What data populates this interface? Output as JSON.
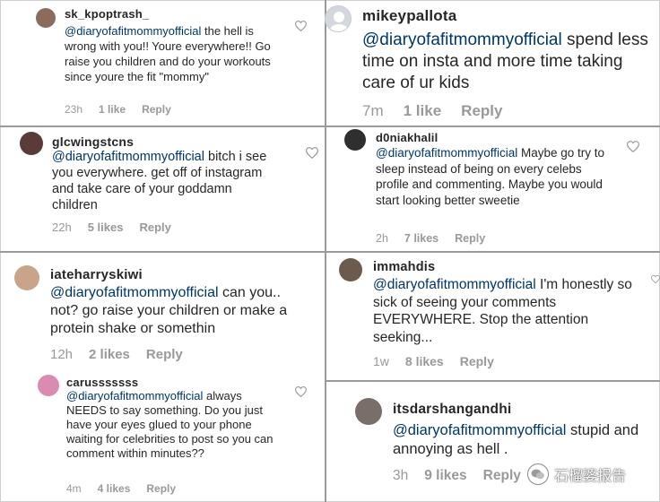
{
  "comments": [
    {
      "username": "sk_kpoptrash_",
      "mention": "@diaryofafitmommyofficial",
      "body": " the hell is wrong with you!! Youre everywhere!! Go raise you children and do your workouts since youre the fit \"mommy\"",
      "time": "23h",
      "likes": "1 like",
      "reply": "Reply",
      "avatar_color": "#8a6b5c"
    },
    {
      "username": "glcwingstcns",
      "mention": "@diaryofafitmommyofficial",
      "body": " bitch i see you everywhere. get off of instagram and take care of your goddamn children",
      "time": "22h",
      "likes": "5 likes",
      "reply": "Reply",
      "avatar_color": "#5b3a3a"
    },
    {
      "username": "iateharryskiwi",
      "mention": "@diaryofafitmommyofficial",
      "body": " can you.. not? go raise your children or make a protein shake or somethin",
      "time": "12h",
      "likes": "2 likes",
      "reply": "Reply",
      "avatar_color": "#c9a48a"
    },
    {
      "username": "carusssssss",
      "mention": "@diaryofafitmommyofficial",
      "body": " always NEEDS to say something. Do you just have your eyes glued to your phone waiting for celebrities to post so you can comment within minutes??",
      "time": "4m",
      "likes": "4 likes",
      "reply": "Reply",
      "avatar_color": "#d98bb0"
    },
    {
      "username": "mikeypallota",
      "mention": "@diaryofafitmommyofficial",
      "body": " spend less time on insta and more time taking care of ur kids",
      "time": "7m",
      "likes": "1 like",
      "reply": "Reply",
      "avatar_color": "#d4d8de"
    },
    {
      "username": "d0niakhalil",
      "mention": "@diaryofafitmommyofficial",
      "body": " Maybe go try to sleep instead of being on every celebs profile and commenting. Maybe you would start looking better sweetie",
      "time": "2h",
      "likes": "7 likes",
      "reply": "Reply",
      "avatar_color": "#2f2f2f"
    },
    {
      "username": "immahdis",
      "mention": "@diaryofafitmommyofficial",
      "body": " I'm honestly so sick of seeing your comments EVERYWHERE. Stop the attention seeking...",
      "time": "1w",
      "likes": "8 likes",
      "reply": "Reply",
      "avatar_color": "#6b5a4e"
    },
    {
      "username": "itsdarshangandhi",
      "mention": "@diaryofafitmommyofficial",
      "body": " stupid and annoying as hell .",
      "time": "3h",
      "likes": "9 likes",
      "reply": "Reply",
      "avatar_color": "#7a6e6a"
    }
  ],
  "watermark": {
    "text": "石榴婆报告"
  },
  "colors": {
    "mention": "#003569",
    "meta": "#999999",
    "username": "#262626",
    "divider": "#9a9a9a"
  }
}
